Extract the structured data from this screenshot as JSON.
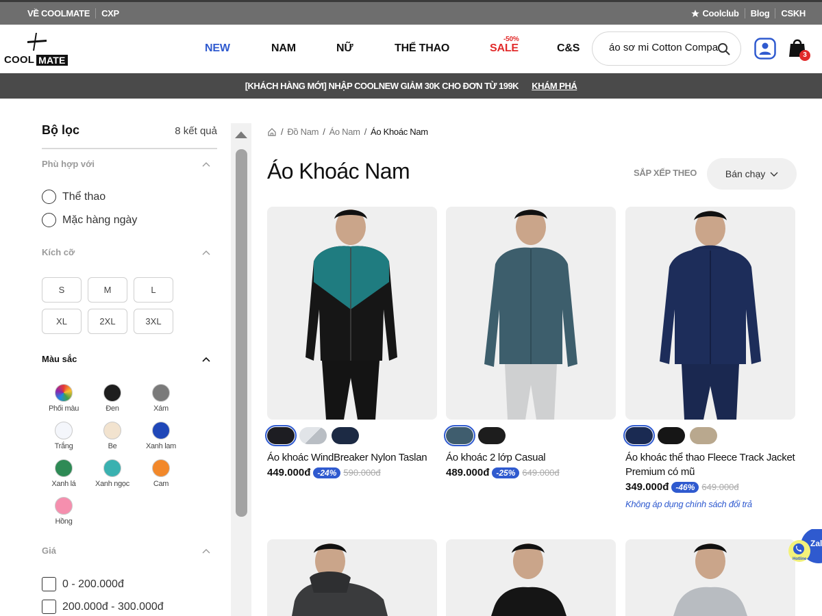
{
  "topbar": {
    "about": "VỀ COOLMATE",
    "cxp": "CXP",
    "coolclub": "Coolclub",
    "blog": "Blog",
    "cskh": "CSKH"
  },
  "logo": {
    "cool": "COOL",
    "mate": "MATE"
  },
  "nav": {
    "new": "NEW",
    "nam": "NAM",
    "nu": "NỮ",
    "thethao": "THỂ THAO",
    "sale": "SALE",
    "sale_badge": "-50%",
    "cs": "C&S"
  },
  "search": {
    "value": "áo sơ mi Cotton Compact"
  },
  "cart": {
    "count": "3"
  },
  "promo": {
    "text": "[KHÁCH HÀNG MỚI] NHẬP COOLNEW GIẢM 30K CHO ĐƠN TỪ 199K",
    "link": "KHÁM PHÁ"
  },
  "filters": {
    "title": "Bộ lọc",
    "results": "8 kết quả",
    "fit": {
      "title": "Phù hợp với",
      "options": [
        "Thể thao",
        "Mặc hàng ngày"
      ]
    },
    "size": {
      "title": "Kích cỡ",
      "options": [
        "S",
        "M",
        "L",
        "XL",
        "2XL",
        "3XL"
      ]
    },
    "color": {
      "title": "Màu sắc",
      "options": [
        {
          "label": "Phối màu",
          "color": "multicolor"
        },
        {
          "label": "Đen",
          "color": "#1e1e1e"
        },
        {
          "label": "Xám",
          "color": "#7a7a7a"
        },
        {
          "label": "Trắng",
          "color": "#f4f6fb"
        },
        {
          "label": "Be",
          "color": "#f2e3cf"
        },
        {
          "label": "Xanh lam",
          "color": "#1f47b8"
        },
        {
          "label": "Xanh lá",
          "color": "#2e8a55"
        },
        {
          "label": "Xanh ngọc",
          "color": "#3ab1b0"
        },
        {
          "label": "Cam",
          "color": "#f2882a"
        },
        {
          "label": "Hồng",
          "color": "#f58fae"
        }
      ]
    },
    "price": {
      "title": "Giá",
      "options": [
        "0 - 200.000đ",
        "200.000đ - 300.000đ"
      ]
    }
  },
  "breadcrumb": {
    "items": [
      "Đồ Nam",
      "Áo Nam"
    ],
    "current": "Áo Khoác Nam"
  },
  "page_title": "Áo Khoác Nam",
  "sort": {
    "label": "SẮP XẾP THEO",
    "value": "Bán chạy"
  },
  "products": [
    {
      "name": "Áo khoác WindBreaker Nylon Taslan",
      "price": "449.000đ",
      "discount": "-24%",
      "old_price": "590.000đ",
      "swatches": [
        "#1d1d22",
        "#c9ced3",
        "#1c2a44"
      ]
    },
    {
      "name": "Áo khoác 2 lớp Casual",
      "price": "489.000đ",
      "discount": "-25%",
      "old_price": "649.000đ",
      "swatches": [
        "#3f5d6e",
        "#1d1d1d"
      ]
    },
    {
      "name": "Áo khoác thể thao Fleece Track Jacket Premium có mũ",
      "price": "349.000đ",
      "discount": "-46%",
      "old_price": "649.000đ",
      "note": "Không áp dụng chính sách đổi trả",
      "swatches": [
        "#1a2a52",
        "#161616",
        "#b9a88e"
      ]
    }
  ],
  "zalo": {
    "label": "Zalo",
    "hotline": "Hotline"
  },
  "colors": {
    "accent": "#2f5acf",
    "sale": "#e12a2a",
    "topbar": "#6e6e6e",
    "promo": "#4a4a4a"
  }
}
